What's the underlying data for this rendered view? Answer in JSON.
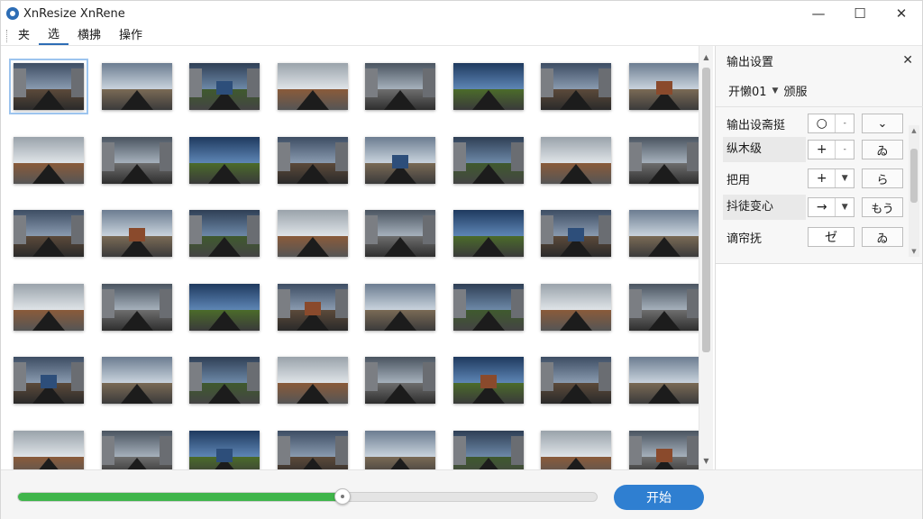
{
  "window": {
    "title": "XnResize XnRene",
    "controls": {
      "minimize": "—",
      "maximize": "☐",
      "close": "✕"
    }
  },
  "menu": {
    "items": [
      "夹",
      "选",
      "横拂",
      "操作"
    ],
    "active_index": 1
  },
  "thumbnails": {
    "columns": 8,
    "rows": 6,
    "selected_index": 0
  },
  "panel": {
    "header": "输出设置",
    "close_icon": "close-icon",
    "preset": {
      "value": "开懒01",
      "separator": "颁服"
    },
    "settings": [
      {
        "label": "输出设斋挺",
        "combo": "○",
        "value": "⌄",
        "highlight": false
      },
      {
        "label": "纵木级",
        "combo": "+",
        "value": "ゐ",
        "highlight": true
      },
      {
        "label": "把用",
        "combo": "+",
        "value": "ら",
        "highlight": false
      },
      {
        "label": "抖徒变心",
        "combo": "→",
        "value": "もう",
        "highlight": true
      },
      {
        "label": "谪帘抚",
        "combo": "ゼ",
        "value": "ゐ",
        "highlight": false
      }
    ]
  },
  "progress": {
    "percent": 56,
    "fill_color": "#3fb54a"
  },
  "actions": {
    "start_label": "开始"
  },
  "colors": {
    "accent": "#2f7fd1",
    "progress": "#3fb54a"
  }
}
